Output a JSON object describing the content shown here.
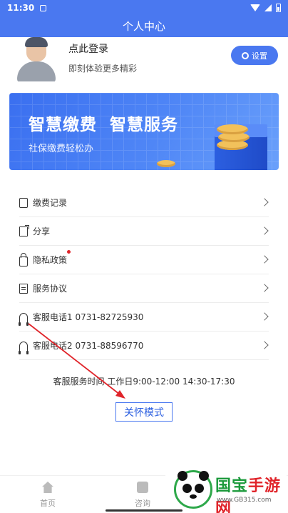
{
  "status_bar": {
    "time": "11:30"
  },
  "title_bar": {
    "title": "个人中心"
  },
  "profile": {
    "login_title": "点此登录",
    "login_subtitle": "即刻体验更多精彩",
    "settings_label": "设置"
  },
  "banner": {
    "title": "智慧缴费  智慧服务",
    "subtitle": "社保缴费轻松办"
  },
  "menu": {
    "items": [
      {
        "label": "缴费记录",
        "icon": "record-icon"
      },
      {
        "label": "分享",
        "icon": "share-icon"
      },
      {
        "label": "隐私政策",
        "icon": "lock-icon"
      },
      {
        "label": "服务协议",
        "icon": "document-icon"
      },
      {
        "label": "客服电话1 0731-82725930",
        "icon": "headset-icon"
      },
      {
        "label": "客服电话2 0731-88596770",
        "icon": "headset-icon"
      }
    ]
  },
  "service_hours": "客服服务时间 工作日9:00-12:00 14:30-17:30",
  "care_mode_label": "关怀模式",
  "tabbar": {
    "items": [
      {
        "label": "首页",
        "icon": "home-icon"
      },
      {
        "label": "咨询",
        "icon": "chat-icon"
      }
    ]
  },
  "watermark": {
    "brand_a": "国宝",
    "brand_b": "手游网",
    "url": "www.GB315.com"
  },
  "colors": {
    "primary": "#4a78f0",
    "accent_red": "#e0242a",
    "watermark_green": "#1c9a3c"
  }
}
